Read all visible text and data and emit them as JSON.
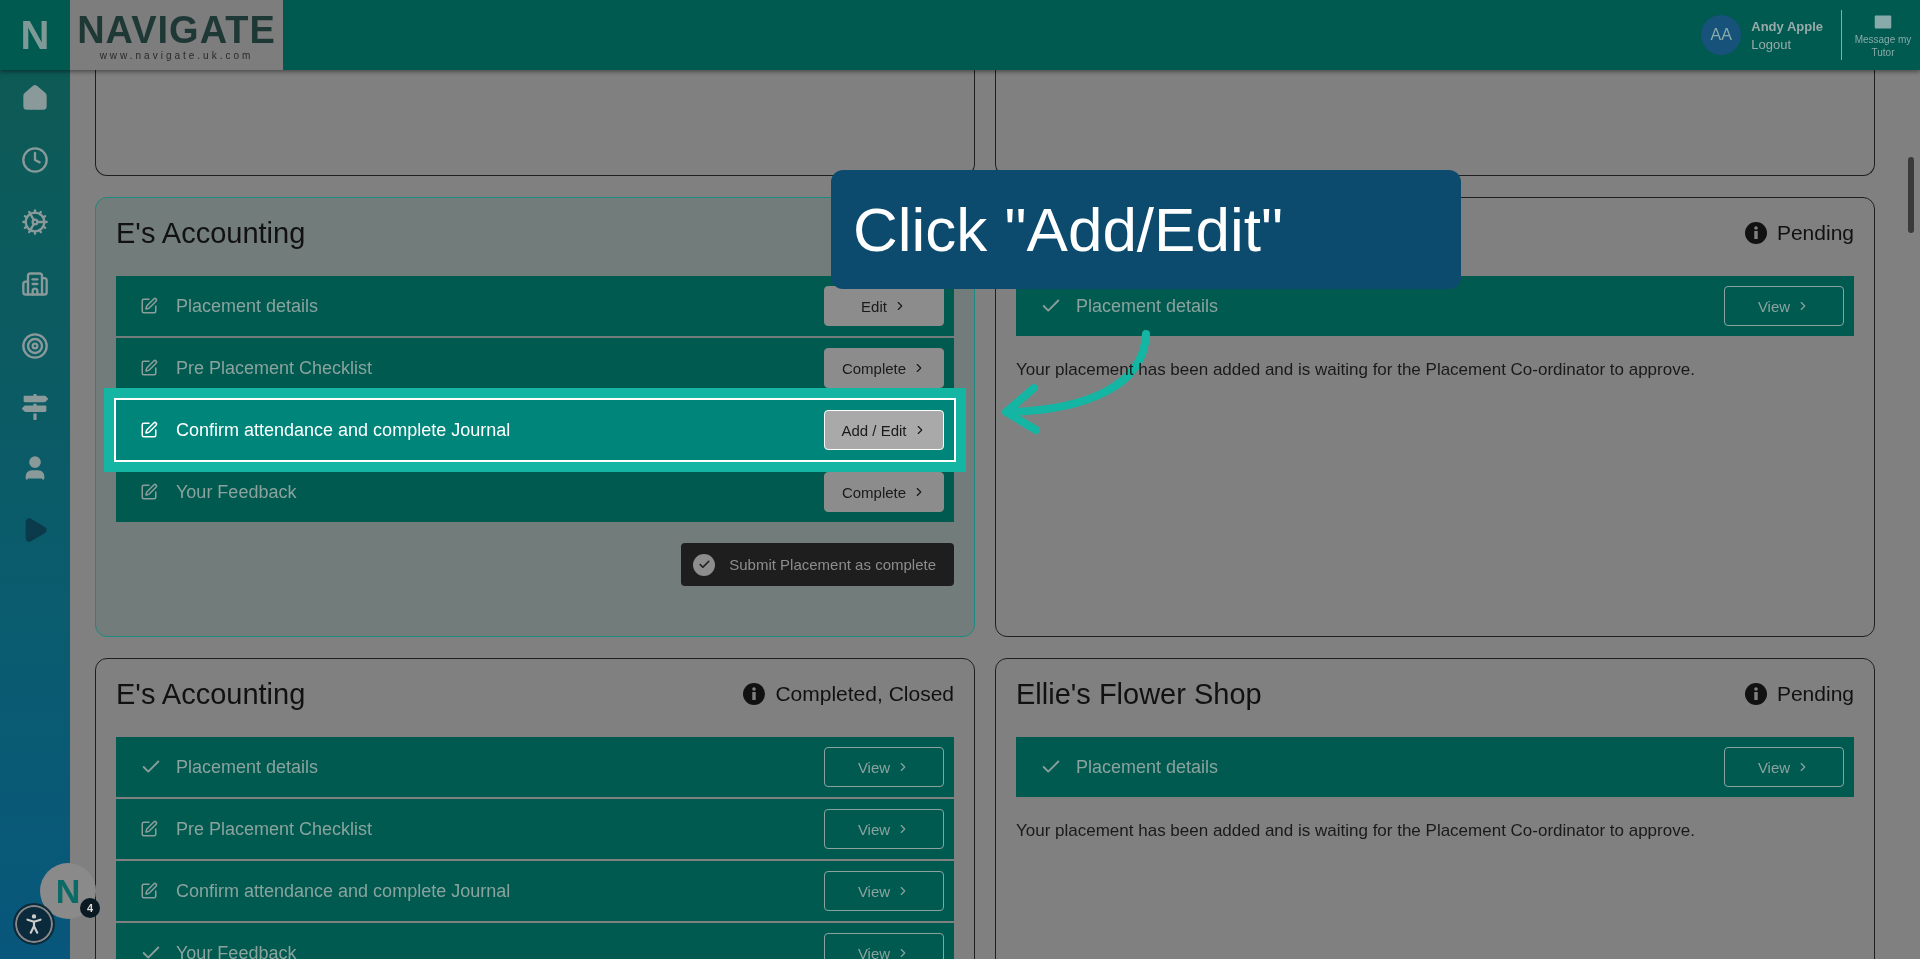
{
  "header": {
    "brand_mark": "N",
    "logo": {
      "wordmark": "NAVIGATE",
      "url": "www.navigate.uk.com"
    },
    "user": {
      "initials": "AA",
      "name": "Andy Apple",
      "logout": "Logout"
    },
    "message_button": "Message my Tutor"
  },
  "cards": [
    {
      "title": "E's Accounting",
      "active": true,
      "rows": [
        {
          "kind": "edit",
          "label": "Placement details",
          "highlighted": false,
          "button": "Edit"
        },
        {
          "kind": "edit",
          "label": "Pre Placement Checklist",
          "highlighted": false,
          "button": "Complete"
        },
        {
          "kind": "edit",
          "label": "Confirm attendance and complete Journal",
          "highlighted": true,
          "button": "Add / Edit"
        },
        {
          "kind": "edit",
          "label": "Your Feedback",
          "highlighted": false,
          "button": "Complete"
        }
      ],
      "submit": "Submit Placement as complete"
    },
    {
      "status": "Pending",
      "active": false,
      "rows": [
        {
          "kind": "done",
          "label": "Placement details",
          "highlighted": false,
          "button": "View"
        }
      ],
      "note": "Your placement has been added and is waiting for the Placement Co-ordinator to approve."
    },
    {
      "title": "E's Accounting",
      "status": "Completed, Closed",
      "active": false,
      "rows": [
        {
          "kind": "done",
          "label": "Placement details",
          "highlighted": false,
          "button": "View"
        },
        {
          "kind": "edit",
          "label": "Pre Placement Checklist",
          "highlighted": false,
          "button": "View"
        },
        {
          "kind": "edit",
          "label": "Confirm attendance and complete Journal",
          "highlighted": false,
          "button": "View"
        },
        {
          "kind": "done",
          "label": "Your Feedback",
          "highlighted": false,
          "button": "View"
        }
      ]
    },
    {
      "title": "Ellie's Flower Shop",
      "status": "Pending",
      "active": false,
      "rows": [
        {
          "kind": "done",
          "label": "Placement details",
          "highlighted": false,
          "button": "View"
        }
      ],
      "note": "Your placement has been added and is waiting for the Placement Co-ordinator to approve."
    }
  ],
  "callout": {
    "text": "Click \"Add/Edit\""
  },
  "help_bubble": {
    "mark": "N",
    "badge": "4"
  }
}
